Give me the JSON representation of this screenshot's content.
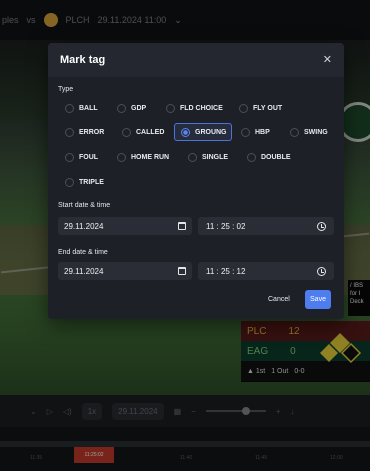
{
  "topbar": {
    "left_text": "ples",
    "vs": "vs",
    "team": "PLCH",
    "datetime": "29.11.2024 11:00"
  },
  "modal": {
    "title": "Mark tag",
    "close_icon": "close-icon",
    "type_label": "Type",
    "options": [
      "BALL",
      "GDP",
      "FLD CHOICE",
      "FLY OUT",
      "ERROR",
      "CALLED",
      "GROUNG",
      "HBP",
      "SWING",
      "FOUL",
      "HOME RUN",
      "SINGLE",
      "DOUBLE",
      "TRIPLE"
    ],
    "selected": "GROUNG",
    "start_label": "Start date & time",
    "start_date": "29.11.2024",
    "start_time": "11 : 25 : 02",
    "end_label": "End date & time",
    "end_date": "29.11.2024",
    "end_time": "11 : 25 : 12",
    "cancel_label": "Cancel",
    "save_label": "Save"
  },
  "scoreboard": {
    "team1": "PLC",
    "score1": "12",
    "team2": "EAG",
    "score2": "0",
    "inning": "▲ 1st",
    "outs": "1 Out",
    "count": "0-0"
  },
  "side_info": "/ IBS for I Deck",
  "controls": {
    "speed": "1x",
    "date": "29.11.2024"
  },
  "timeline": {
    "labels": [
      "11:35",
      "11:40",
      "11:45",
      "12:00"
    ],
    "playhead": "11:25:02"
  },
  "colors": {
    "accent": "#4e7df0",
    "modal_bg": "#1e2028",
    "plc": "#f0c43a",
    "eag": "#7fd07f"
  }
}
